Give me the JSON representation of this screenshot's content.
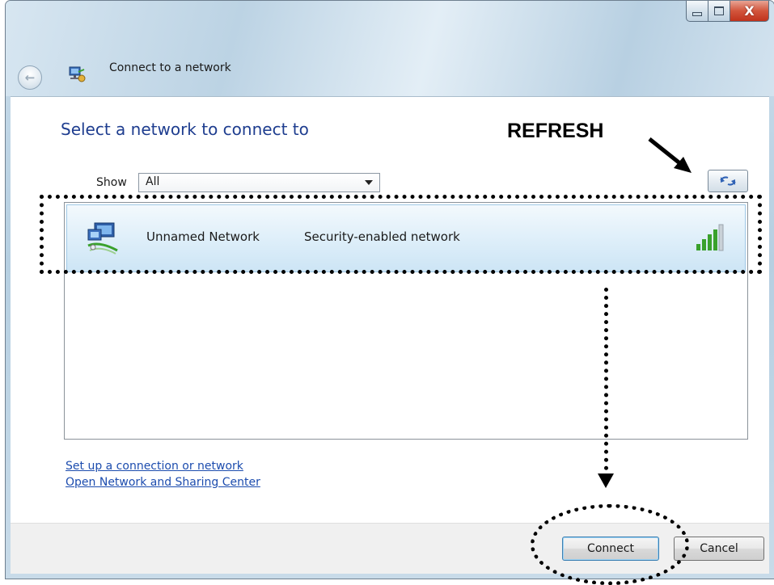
{
  "window": {
    "title": "Connect to a network",
    "controls": {
      "minimize_icon": "minimize-icon",
      "maximize_icon": "maximize-icon",
      "close_icon": "close-icon",
      "close_glyph": "X"
    },
    "back_glyph": "←"
  },
  "main": {
    "heading": "Select a network to connect to",
    "show_label": "Show",
    "show_value": "All",
    "refresh_icon": "refresh-icon"
  },
  "networks": [
    {
      "name": "Unnamed Network",
      "security": "Security-enabled network",
      "icon": "wireless-network-icon",
      "signal_icon": "signal-strength-icon"
    }
  ],
  "links": {
    "setup": "Set up a connection or network",
    "sharing_center": "Open Network and Sharing Center"
  },
  "footer": {
    "connect_label": "Connect",
    "cancel_label": "Cancel"
  },
  "annotations": {
    "refresh_label": "REFRESH"
  },
  "colors": {
    "heading": "#1e3d8f",
    "link": "#1c4cae",
    "selection": "#ddeef9",
    "signal_green": "#3aa12c"
  }
}
